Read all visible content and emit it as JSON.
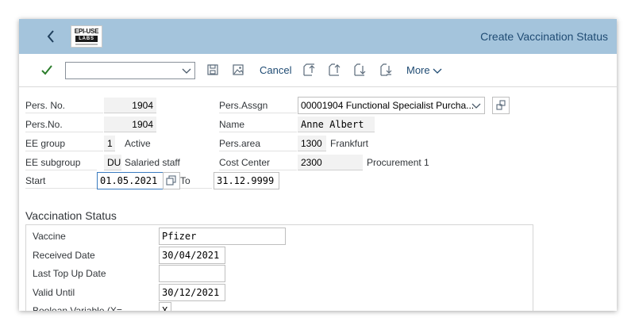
{
  "header": {
    "title": "Create Vaccination Status",
    "logo": {
      "brand": "EPI-USE",
      "sub": "LABS"
    }
  },
  "toolbar": {
    "command_value": "",
    "cancel_label": "Cancel",
    "more_label": "More"
  },
  "header_fields": {
    "pers_no_label": "Pers. No.",
    "pers_no_value": "1904",
    "pers_no2_label": "Pers.No.",
    "pers_no2_value": "1904",
    "ee_group_label": "EE group",
    "ee_group_code": "1",
    "ee_group_text": "Active",
    "ee_subgroup_label": "EE subgroup",
    "ee_subgroup_code": "DU",
    "ee_subgroup_text": "Salaried staff",
    "start_label": "Start",
    "start_value": "01.05.2021",
    "to_label": "To",
    "to_value": "31.12.9999",
    "pers_assgn_label": "Pers.Assgn",
    "pers_assgn_value": "00001904 Functional Specialist Purcha...",
    "name_label": "Name",
    "name_value": "Anne Albert",
    "pers_area_label": "Pers.area",
    "pers_area_code": "1300",
    "pers_area_text": "Frankfurt",
    "cost_center_label": "Cost Center",
    "cost_center_code": "2300",
    "cost_center_text": "Procurement 1"
  },
  "vaccination": {
    "section_title": "Vaccination Status",
    "vaccine_label": "Vaccine",
    "vaccine_value": "Pfizer",
    "received_label": "Received Date",
    "received_value": "30/04/2021",
    "topup_label": "Last Top Up Date",
    "topup_value": "",
    "valid_label": "Valid Until",
    "valid_value": "30/12/2021",
    "boolean_label": "Boolean Variable (X=",
    "boolean_value": "X"
  },
  "colors": {
    "shellbar": "#a4c4dc",
    "title": "#1f4b73",
    "accent": "#0a6ed1",
    "check": "#2b7d2b"
  }
}
